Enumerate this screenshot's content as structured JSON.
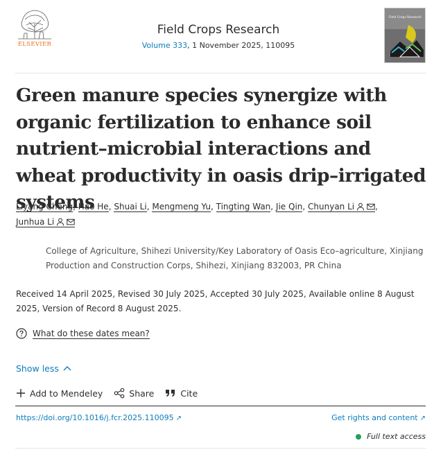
{
  "header": {
    "publisher": "ELSEVIER",
    "journal_title": "Field Crops Research",
    "volume_link": "Volume 333",
    "issue_rest": ", 1 November 2025, 110095",
    "cover_text": "Field Crops Research"
  },
  "article": {
    "title": "Green manure species synergize with organic fertilization to enhance soil nutrient–microbial interactions and wheat productivity in oasis drip–irrigated systems"
  },
  "authors": [
    {
      "name": "Liyang Cheng",
      "sep": ", "
    },
    {
      "name": "Hao He",
      "sep": ", "
    },
    {
      "name": "Shuai Li",
      "sep": ", "
    },
    {
      "name": "Mengmeng Yu",
      "sep": ", "
    },
    {
      "name": "Tingting Wan",
      "sep": ", "
    },
    {
      "name": "Jie Qin",
      "sep": ", "
    },
    {
      "name": "Chunyan Li",
      "sep": ","
    },
    {
      "name": "Junhua Li",
      "sep": ""
    }
  ],
  "affiliation": "College of Agriculture, Shihezi University/Key Laboratory of Oasis Eco–agriculture, Xinjiang Production and Construction Corps, Shihezi, Xinjiang 832003, PR China",
  "dates": "Received 14 April 2025, Revised 30 July 2025, Accepted 30 July 2025, Available online 8 August 2025, Version of Record 8 August 2025.",
  "dates_help": "What do these dates mean?",
  "show_less": "Show less",
  "actions": {
    "mendeley": "Add to Mendeley",
    "share": "Share",
    "cite": "Cite"
  },
  "links": {
    "doi": "https://doi.org/10.1016/j.fcr.2025.110095",
    "rights": "Get rights and content",
    "access": "Full text access"
  },
  "colors": {
    "link": "#0c7dbb",
    "publisher_orange": "#e9711c",
    "access_green": "#2a9d5a"
  }
}
